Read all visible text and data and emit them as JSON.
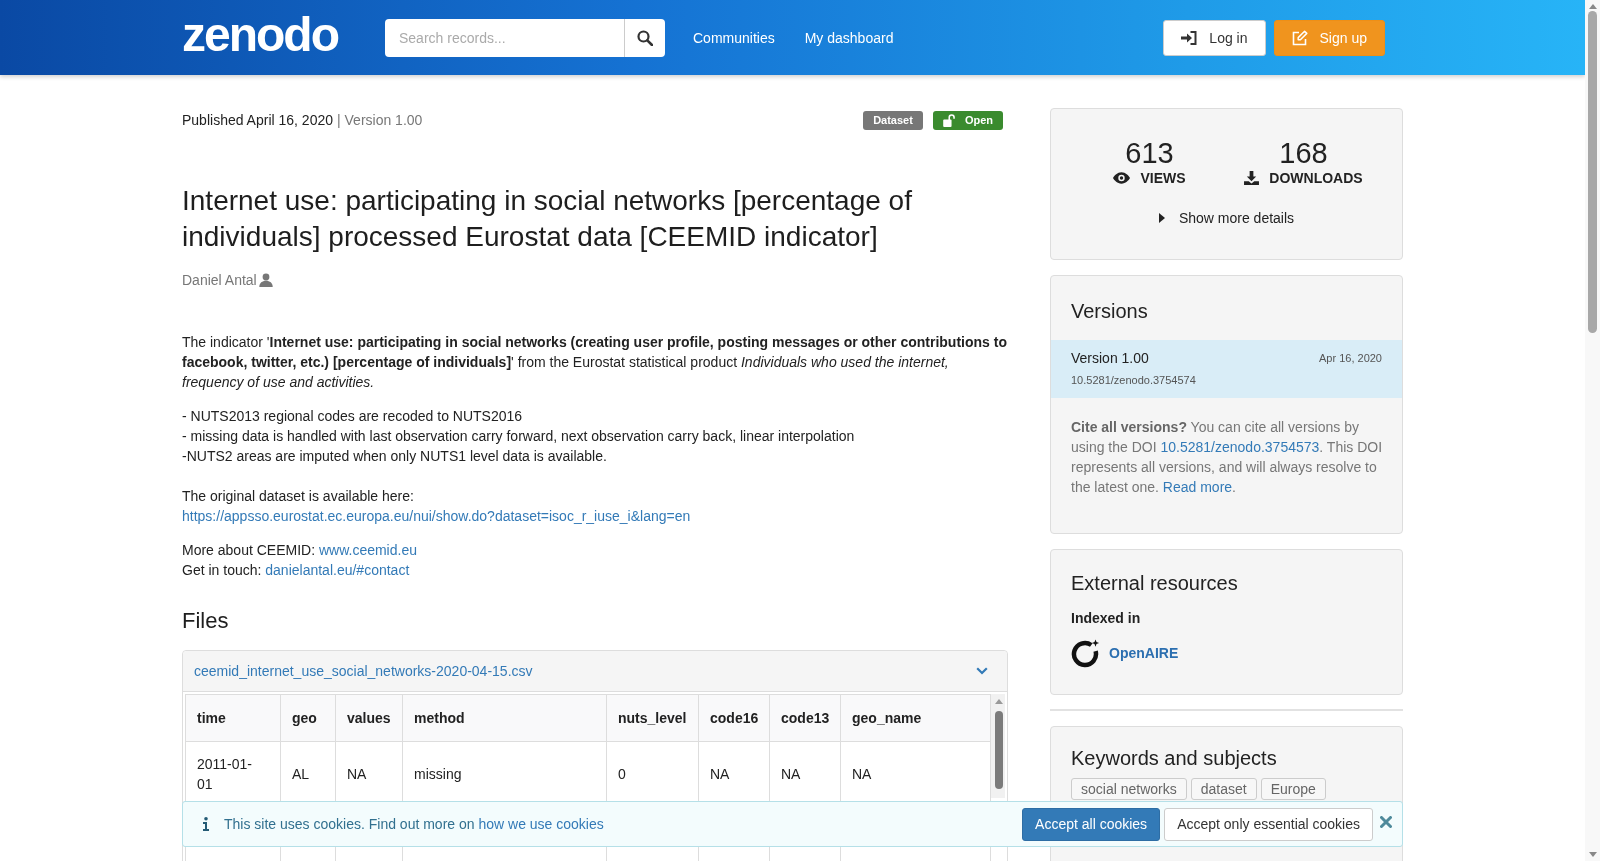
{
  "header": {
    "logo": "zenodo",
    "search": {
      "placeholder": "Search records..."
    },
    "nav": [
      "Communities",
      "My dashboard"
    ],
    "buttons": [
      {
        "label": "Log in",
        "kind": "login"
      },
      {
        "label": "Sign up",
        "kind": "signup"
      }
    ]
  },
  "record": {
    "published": "Published April 16, 2020",
    "version": "| Version 1.00",
    "badges": [
      {
        "label": "Dataset",
        "kind": "type"
      },
      {
        "label": "Open",
        "kind": "access"
      }
    ],
    "title": "Internet use: participating in social networks [percentage of individuals] processed Eurostat data [CEEMID indicator]",
    "author": "Daniel Antal",
    "intro": "The indicator '**Internet use: participating in social networks (creating user profile, posting messages or other contributions to facebook, twitter, etc.) [percentage of individuals]**' from the Eurostat statistical product *Individuals who used the internet, frequency of use and activities.*",
    "notes": [
      "- NUTS2013 regional codes are recoded to NUTS2016",
      "- missing data is handled with last observation carry forward, next observation carry back, linear interpolation",
      "-NUTS2 areas are imputed when only NUTS1 level data is available."
    ],
    "source": {
      "label": "The original dataset is available here:",
      "link": "https://appsso.eurostat.ec.europa.eu/nui/show.do?dataset=isoc_r_iuse_i&lang=en"
    },
    "contacts": [
      {
        "label": "More about CEEMID:",
        "link": "www.ceemid.eu"
      },
      {
        "label": "Get in touch:",
        "link": "danielantal.eu/#contact"
      }
    ]
  },
  "files": {
    "title": "Files",
    "file": {
      "name": "ceemid_internet_use_social_networks-2020-04-15.csv",
      "expanded": true
    },
    "columns": [
      "time",
      "geo",
      "values",
      "method",
      "nuts_level",
      "code16",
      "code13",
      "geo_name"
    ],
    "rows": [
      {
        "cells": [
          "2011-01-01",
          "AL",
          "NA",
          "missing",
          "0",
          "NA",
          "NA",
          "NA"
        ]
      }
    ]
  },
  "stats": {
    "items": [
      {
        "value": "613",
        "label": "VIEWS",
        "kind": "views"
      },
      {
        "value": "168",
        "label": "DOWNLOADS",
        "kind": "downloads"
      }
    ],
    "details": {
      "label": "Show more details",
      "expanded": false
    }
  },
  "versions": {
    "title": "Versions",
    "items": [
      {
        "version": "Version 1.00",
        "date": "Apr 16, 2020",
        "doi": "10.5281/zenodo.3754574",
        "selected": true
      }
    ],
    "cite": [
      {
        "kind": "text",
        "text": "**Cite all versions?** You can cite all versions by using the DOI "
      },
      {
        "kind": "link",
        "text": "10.5281/zenodo.3754573"
      },
      {
        "kind": "text",
        "text": ". This DOI represents all versions, and will always resolve to the latest one. "
      },
      {
        "kind": "link",
        "text": "Read more"
      },
      {
        "kind": "text",
        "text": "."
      }
    ]
  },
  "external": {
    "title": "External resources",
    "subtitle": "Indexed in",
    "links": [
      {
        "label": "OpenAIRE"
      }
    ]
  },
  "keywords": {
    "title": "Keywords and subjects",
    "tags": [
      "social networks",
      "dataset",
      "Europe"
    ]
  },
  "cookie_banner": {
    "text": "This site uses cookies. Find out more on",
    "link": "how we use cookies",
    "buttons": [
      {
        "label": "Accept all cookies",
        "kind": "primary"
      },
      {
        "label": "Accept only essential cookies",
        "kind": "default"
      }
    ]
  }
}
